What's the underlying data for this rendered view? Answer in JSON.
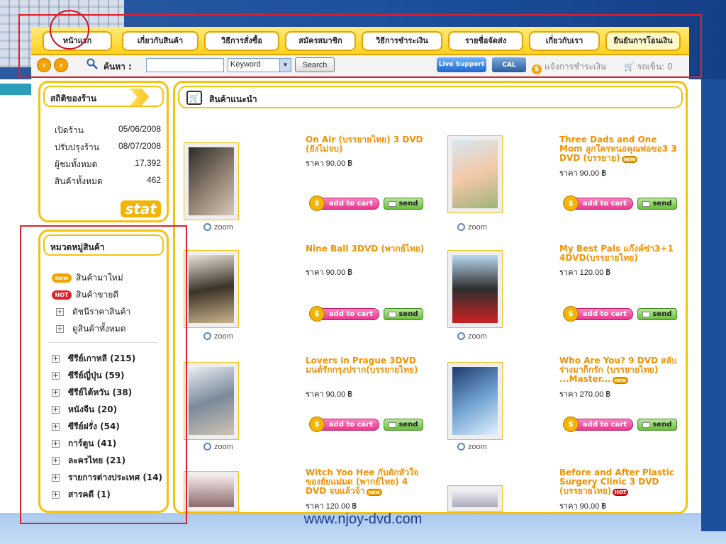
{
  "nav": {
    "items": [
      "หน้าแรก",
      "เกี่ยวกับสินค้า",
      "วิธีการสั่งซื้อ",
      "สมัครสมาชิก",
      "วิธีการชำระเงิน",
      "รายชื่อจัดส่ง",
      "เกี่ยวกับเรา",
      "ยืนยันการโอนเงิน"
    ]
  },
  "search": {
    "label": "ค้นหา :",
    "input_value": "",
    "select_value": "Keyword",
    "button": "Search",
    "live_support": "Live Support",
    "cal": "CAL",
    "payment_notice": "แจ้งการชำระเงิน",
    "cart": "รถเข็น: 0"
  },
  "stats": {
    "title": "สถิติของร้าน",
    "rows": [
      {
        "label": "เปิดร้าน",
        "value": "05/06/2008"
      },
      {
        "label": "ปรับปรุงร้าน",
        "value": "08/07/2008"
      },
      {
        "label": "ผู้ชมทั้งหมด",
        "value": "17,392"
      },
      {
        "label": "สินค้าทั้งหมด",
        "value": "462"
      }
    ],
    "logo": "stat"
  },
  "categories": {
    "title": "หมวดหมู่สินค้า",
    "quick": [
      {
        "badge": "new",
        "label": "สินค้ามาใหม่"
      },
      {
        "badge": "HOT",
        "label": "สินค้าขายดี"
      },
      {
        "badge": "",
        "label": "ดัชนีราคาสินค้า"
      },
      {
        "badge": "",
        "label": "ดูสินค้าทั้งหมด"
      }
    ],
    "items": [
      "ซีรีย์เกาหลี (215)",
      "ซีรีย์ญี่ปุ่น (59)",
      "ซีรีย์ไต้หวัน (38)",
      "หนังจีน (20)",
      "ซีรีย์ฝรั่ง (54)",
      "การ์ตูน (41)",
      "ละครไทย (21)",
      "รายการต่างประเทศ (14)",
      "สารคดี (1)"
    ]
  },
  "main": {
    "title": "สินค้าแนะนำ",
    "add_to_cart": "add to cart",
    "send": "send",
    "zoom": "zoom",
    "products": [
      {
        "title": "On Air (บรรยายไทย) 3 DVD (ยังไม่จบ)",
        "price": "ราคา 90.00 ฿",
        "badge": ""
      },
      {
        "title": "Three Dads and One Mom ลูกใครหนอคุณพ่อขอ3 3 DVD (บรรยาย)",
        "price": "ราคา 90.00 ฿",
        "badge": "new"
      },
      {
        "title": "Nine Ball 3DVD (พากย์ไทย)",
        "price": "ราคา 90.00 ฿",
        "badge": ""
      },
      {
        "title": "My Best Pals แก๊งค์ซ่า3+1 4DVD(บรรยายไทย)",
        "price": "ราคา 120.00 ฿",
        "badge": ""
      },
      {
        "title": "Lovers in Prague 3DVD มนต์รักกรุงปราก(บรรยายไทย)",
        "price": "ราคา 90.00 ฿",
        "badge": ""
      },
      {
        "title": "Who Are You? 9 DVD สลับร่างมาก็กรัก (บรรยายไทย) ...Master...",
        "price": "ราคา 270.00 ฿",
        "badge": "new"
      },
      {
        "title": "Witch Yoo Hee กับดักหัวใจของยัยแม่มด (พากย์ไทย) 4 DVD จบแล้วจ้า",
        "price": "ราคา 120.00 ฿",
        "badge": "new"
      },
      {
        "title": "Before and After Plastic Surgery Clinic 3 DVD (บรรยายไทย)",
        "price": "ราคา 90.00 ฿",
        "badge": "HOT"
      }
    ]
  },
  "footer": {
    "url": "www.njoy-dvd.com"
  }
}
